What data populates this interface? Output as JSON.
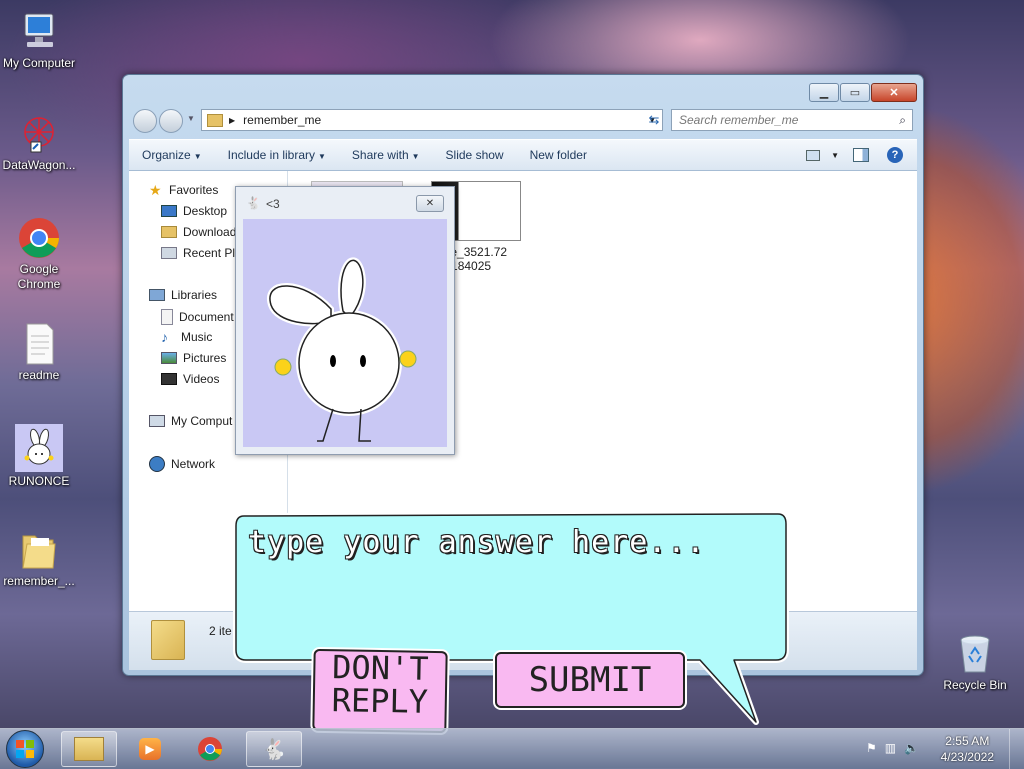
{
  "desktop": {
    "icons": [
      {
        "label": "My Computer"
      },
      {
        "label": "DataWagon..."
      },
      {
        "label": "Google Chrome"
      },
      {
        "label": "readme"
      },
      {
        "label": "RUNONCE"
      },
      {
        "label": "remember_..."
      },
      {
        "label": "Recycle Bin"
      }
    ]
  },
  "explorer": {
    "address": "remember_me",
    "search_placeholder": "Search remember_me",
    "toolbar": [
      "Organize",
      "Include in library",
      "Share with",
      "Slide show",
      "New folder"
    ],
    "nav": {
      "favorites": "Favorites",
      "desktop": "Desktop",
      "downloads": "Download",
      "recent": "Recent Pla",
      "libraries": "Libraries",
      "documents": "Document",
      "music": "Music",
      "pictures": "Pictures",
      "videos": "Videos",
      "computer": "My Comput",
      "network": "Network"
    },
    "file_label_line1": "once_3521.72",
    "file_label_line2": "858184025",
    "status": "2 ite"
  },
  "popup": {
    "title": "<3"
  },
  "dialog": {
    "input_placeholder": "type your answer here...",
    "dont_reply_line1": "DON'T",
    "dont_reply_line2": "REPLY",
    "submit": "SUBMIT"
  },
  "taskbar": {
    "time": "2:55 AM",
    "date": "4/23/2022"
  },
  "colors": {
    "bubble": "#b2fbfb",
    "button": "#f9b9f1",
    "popup_bg": "#c9c8f4"
  }
}
